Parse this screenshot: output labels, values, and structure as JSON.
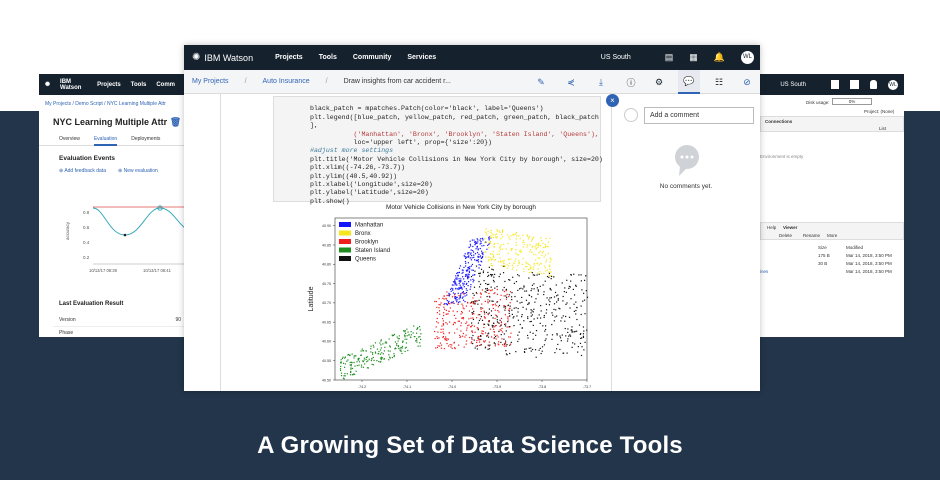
{
  "caption": "A Growing Set of Data Science Tools",
  "left_window": {
    "brand": "IBM Watson",
    "nav": [
      "Projects",
      "Tools",
      "Comm"
    ],
    "breadcrumb": "My Projects   /   Demo Script   /   NYC Learning Multiple Attr",
    "title": "NYC Learning Multiple Attr",
    "tabs": [
      "Overview",
      "Evaluation",
      "Deployments"
    ],
    "active_tab": "Evaluation",
    "section_title": "Evaluation Events",
    "links": [
      "Add feedback data",
      "New evaluation"
    ],
    "chart_yticks": [
      "0.8",
      "0.6",
      "0.4",
      "0.2"
    ],
    "chart_ylabel": "accuracy",
    "chart_xticks": [
      "10/13/17 08:39",
      "10/13/17 08:41"
    ],
    "result_title": "Last Evaluation Result",
    "result_rows": [
      {
        "label": "Version",
        "value": "90"
      },
      {
        "label": "Phase",
        "value": ""
      }
    ]
  },
  "right_window": {
    "region": "US South",
    "avatar": "WL",
    "disk_usage_label": "Disk usage:",
    "disk_value": "0%",
    "project_label": "Project: (None)",
    "connections_label": "Connections",
    "list_label": "List",
    "empty_text": "Environment is empty",
    "tabs": [
      "Help",
      "Viewer"
    ],
    "actions": [
      "Delete",
      "Rename",
      "More"
    ],
    "col_size": "Size",
    "col_modified": "Modified",
    "rows": [
      {
        "size": "175 B",
        "modified": "Mar 14, 2018, 3:50 PM"
      },
      {
        "size": "30 B",
        "modified": "Mar 14, 2018, 3:50 PM"
      },
      {
        "size": "",
        "modified": "Mar 14, 2018, 3:50 PM"
      }
    ],
    "side_link": "ines"
  },
  "main_window": {
    "brand": "IBM Watson",
    "nav": [
      "Projects",
      "Tools",
      "Community",
      "Services"
    ],
    "region": "US South",
    "avatar": "WL",
    "breadcrumb": {
      "root": "My Projects",
      "project": "Auto Insurance",
      "current": "Draw insights from car accident r..."
    },
    "code_lines": [
      "black_patch = mpatches.Patch(color='black', label='Queens')",
      "plt.legend([blue_patch, yellow_patch, red_patch, green_patch, black_patch",
      "],",
      "           ('Manhattan', 'Bronx', 'Brooklyn', 'Staten Island', 'Queens'),",
      "           loc='upper left', prop={'size':20})",
      "",
      "#adjust more settings",
      "plt.title('Motor Vehicle Collisions in New York City by borough', size=20)",
      "plt.xlim((-74.26,-73.7))",
      "plt.ylim((40.5,40.92))",
      "plt.xlabel('Longitude',size=20)",
      "plt.ylabel('Latitude',size=20)",
      "plt.show()"
    ],
    "comment_placeholder": "Add a comment",
    "no_comments": "No comments yet."
  },
  "chart_data": {
    "type": "scatter",
    "title": "Motor Vehicle Collisions in New York City by borough",
    "xlabel": "Longitude",
    "ylabel": "Latitude",
    "xlim": [
      -74.26,
      -73.7
    ],
    "ylim": [
      40.5,
      40.92
    ],
    "xticks": [
      "-74.2",
      "-74.1",
      "-74.0",
      "-73.9",
      "-73.8",
      "-73.7"
    ],
    "yticks": [
      "40.90",
      "40.85",
      "40.80",
      "40.75",
      "40.70",
      "40.65",
      "40.60",
      "40.55",
      "40.50"
    ],
    "legend_position": "upper left",
    "series": [
      {
        "name": "Manhattan",
        "color": "#1414ff",
        "region": {
          "lon": [
            -74.02,
            -73.92
          ],
          "lat": [
            40.7,
            40.88
          ]
        }
      },
      {
        "name": "Bronx",
        "color": "#f5e61e",
        "region": {
          "lon": [
            -73.93,
            -73.78
          ],
          "lat": [
            40.8,
            40.91
          ]
        }
      },
      {
        "name": "Brooklyn",
        "color": "#f01e1e",
        "region": {
          "lon": [
            -74.04,
            -73.86
          ],
          "lat": [
            40.57,
            40.74
          ]
        }
      },
      {
        "name": "Staten Island",
        "color": "#1e8c1e",
        "region": {
          "lon": [
            -74.25,
            -74.06
          ],
          "lat": [
            40.5,
            40.65
          ]
        }
      },
      {
        "name": "Queens",
        "color": "#111111",
        "region": {
          "lon": [
            -73.96,
            -73.7
          ],
          "lat": [
            40.54,
            40.8
          ]
        }
      }
    ]
  }
}
